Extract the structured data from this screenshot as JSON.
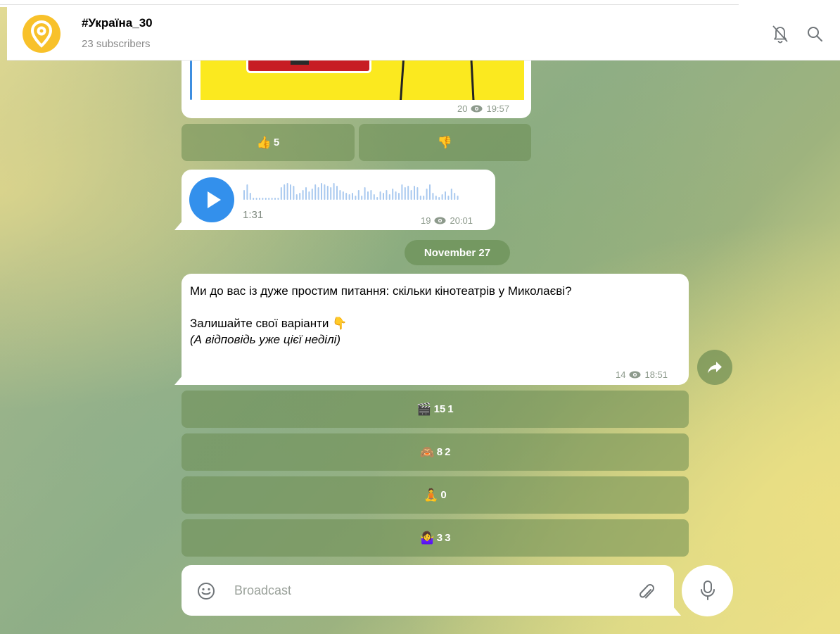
{
  "header": {
    "title": "#Україна_30",
    "subtitle": "23 subscribers",
    "icons": [
      "location-pin-icon",
      "bell-off-icon",
      "search-icon"
    ]
  },
  "messages": [
    {
      "type": "photo",
      "views": "20",
      "time": "19:57",
      "reactions": [
        {
          "emoji": "👍",
          "count": "5"
        },
        {
          "emoji": "👎",
          "count": ""
        }
      ]
    },
    {
      "type": "voice",
      "duration": "1:31",
      "views": "19",
      "time": "20:01"
    }
  ],
  "date_separator": "November 27",
  "poll_message": {
    "lines": [
      "Ми до вас із дуже простим питання: скільки кінотеатрів у Миколаєві?",
      "Залишайте свої варіанти 👇",
      "(А відповідь уже цієї неділі)"
    ],
    "views": "14",
    "time": "18:51",
    "options": [
      {
        "emoji": "🎬",
        "label": "15",
        "count": "1"
      },
      {
        "emoji": "🙈",
        "label": "8",
        "count": "2"
      },
      {
        "emoji": "🧘",
        "label": "",
        "count": "0"
      },
      {
        "emoji": "🤷‍♀️",
        "label": "3",
        "count": "3"
      }
    ]
  },
  "composer": {
    "placeholder": "Broadcast",
    "icons": [
      "emoji-icon",
      "attach-icon",
      "microphone-icon"
    ]
  },
  "colors": {
    "accent_blue": "#3390ec",
    "avatar_yellow": "#f8c12a",
    "button_green": "#6c8c52"
  }
}
